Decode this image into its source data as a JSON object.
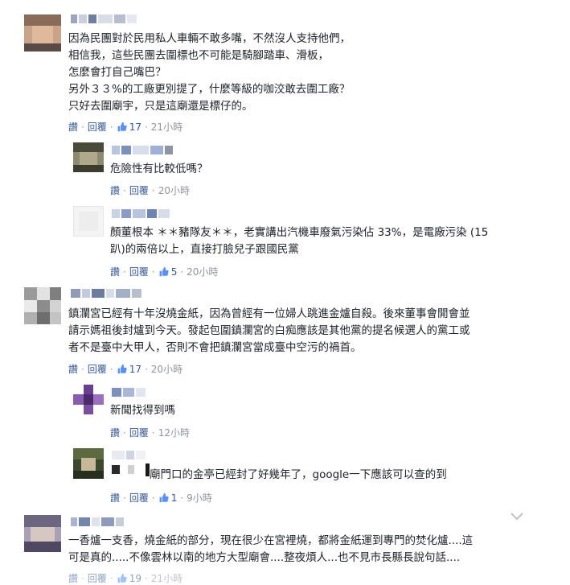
{
  "labels": {
    "like": "讚",
    "reply": "回覆",
    "dot": "·"
  },
  "comments": [
    {
      "lines": [
        "因為民團對於民用私人車輛不敢多嘴，不然沒人支持他們，",
        "相信我，這些民團去圍標也不可能是騎腳踏車、滑板，",
        "怎麼會打自己嘴巴？",
        "另外３３%的工廠更別提了，什麼等級的咖洨敢去圍工廠？",
        "只好去圍廟宇，只是這廟還是標仔的。"
      ],
      "likes": "17",
      "time": "21小時"
    },
    {
      "lines": [
        "危險性有比較低嗎？"
      ],
      "likes": "",
      "time": "20小時"
    },
    {
      "lines": [
        "顏董根本 ＊＊豬隊友＊＊，老實講出汽機車廢氣污染佔 33%，是電廠污染 (15",
        "趴)的兩倍以上，直接打臉兒子跟國民黨"
      ],
      "likes": "5",
      "time": "20小時"
    },
    {
      "lines": [
        "鎮瀾宮已經有十年沒燒金紙，因為曾經有一位婦人跳進金爐自殺。後來董事會開會並",
        "請示媽祖後封爐到今天。發起包圍鎮瀾宮的白痴應該是其他黨的提名候選人的黨工或",
        "者不是臺中大甲人，否則不會把鎮瀾宮當成臺中空污的禍首。"
      ],
      "likes": "17",
      "time": "20小時"
    },
    {
      "lines": [
        "新聞找得到嗎"
      ],
      "likes": "",
      "time": "12小時"
    },
    {
      "lines": [
        "廟門口的金亭已經封了好幾年了，google一下應該可以查的到"
      ],
      "likes": "1",
      "time": "9小時"
    },
    {
      "lines": [
        "一香爐一支香，燒金紙的部分，現在很少在宮裡燒，都將金紙運到專門的焚化爐....這",
        "可是真的.....不像雲林以南的地方大型廟會....整夜煩人...也不見市長縣長說句話...."
      ],
      "likes": "19",
      "time": "21小時"
    }
  ]
}
